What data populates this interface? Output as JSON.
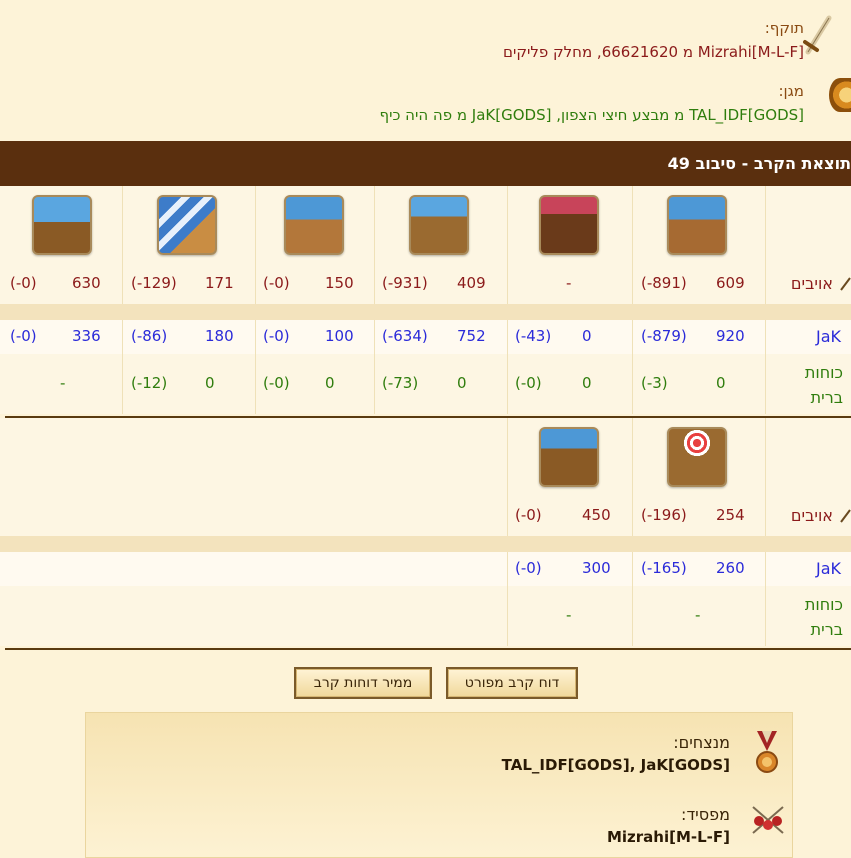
{
  "attacker": {
    "label": "תוקף:",
    "text": "Mizrahi[M-L-F] מ 66621620, מחלק פליקים"
  },
  "defender": {
    "label": "מגן:",
    "text": "TAL_IDF[GODS] מ מבצע חיצי הצפון, JaK[GODS] מ פה היה כיף"
  },
  "header": {
    "title": "תוצאת הקרב - סיבוב 49"
  },
  "rows": {
    "enemies_label": "אויבים",
    "jak_label": "JaK",
    "allies_label": "כוחות ברית"
  },
  "table1": {
    "enemies": [
      {
        "val": "609",
        "loss": "(-891)"
      },
      {
        "val": "-",
        "loss": ""
      },
      {
        "val": "409",
        "loss": "(-931)"
      },
      {
        "val": "150",
        "loss": "(-0)"
      },
      {
        "val": "171",
        "loss": "(-129)"
      },
      {
        "val": "630",
        "loss": "(-0)"
      }
    ],
    "jak": [
      {
        "val": "920",
        "loss": "(-879)"
      },
      {
        "val": "0",
        "loss": "(-43)"
      },
      {
        "val": "752",
        "loss": "(-634)"
      },
      {
        "val": "100",
        "loss": "(-0)"
      },
      {
        "val": "180",
        "loss": "(-86)"
      },
      {
        "val": "336",
        "loss": "(-0)"
      }
    ],
    "allies": [
      {
        "val": "0",
        "loss": "(-3)"
      },
      {
        "val": "0",
        "loss": "(-0)"
      },
      {
        "val": "0",
        "loss": "(-73)"
      },
      {
        "val": "0",
        "loss": "(-0)"
      },
      {
        "val": "0",
        "loss": "(-12)"
      },
      {
        "val": "-",
        "loss": ""
      }
    ]
  },
  "table2": {
    "enemies": [
      {
        "val": "254",
        "loss": "(-196)"
      },
      {
        "val": "450",
        "loss": "(-0)"
      }
    ],
    "jak": [
      {
        "val": "260",
        "loss": "(-165)"
      },
      {
        "val": "300",
        "loss": "(-0)"
      }
    ],
    "allies": [
      {
        "val": "-",
        "loss": ""
      },
      {
        "val": "-",
        "loss": ""
      }
    ]
  },
  "buttons": {
    "detailed_report": "דוח קרב מפורט",
    "report_converter": "ממיר דוחות קרב"
  },
  "summary": {
    "winners_label": "מנצחים:",
    "winners": "TAL_IDF[GODS], JaK[GODS]",
    "loser_label": "מפסיד:",
    "loser": "Mizrahi[M-L-F]"
  },
  "colors": {
    "header_bg": "#5a2f0e",
    "enemy": "#8b1a1a",
    "jak": "#2b2bd9",
    "allies": "#2f7d0d"
  },
  "icons": [
    "sword-icon",
    "shield-icon",
    "ship-icons",
    "medal-icon",
    "crossed-swords-icon"
  ]
}
